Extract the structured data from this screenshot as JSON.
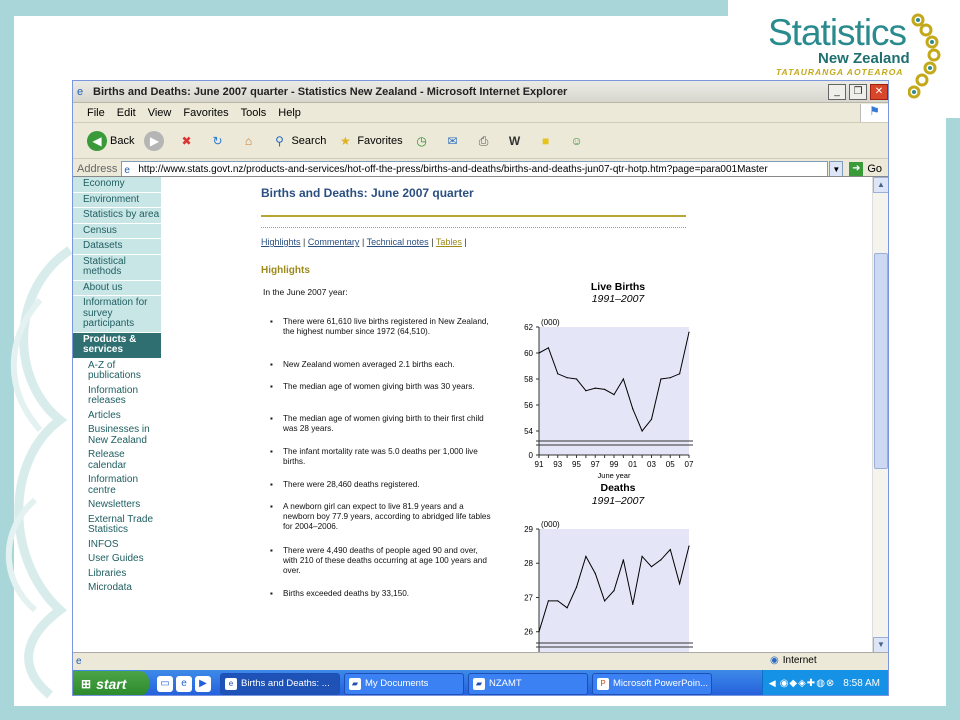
{
  "slide": {
    "logo": {
      "word": "Statistics",
      "country": "New Zealand",
      "tagline": "TATAURANGA AOTEAROA"
    }
  },
  "window": {
    "title": "Births and Deaths: June 2007 quarter - Statistics New Zealand - Microsoft Internet Explorer",
    "controls": {
      "minimize": "_",
      "maximize": "❐",
      "close": "✕"
    },
    "menu": [
      "File",
      "Edit",
      "View",
      "Favorites",
      "Tools",
      "Help"
    ],
    "toolbar": {
      "back": "Back",
      "search": "Search",
      "favorites": "Favorites"
    },
    "address": {
      "label": "Address",
      "url": "http://www.stats.govt.nz/products-and-services/hot-off-the-press/births-and-deaths/births-and-deaths-jun07-qtr-hotp.htm?page=para001Master",
      "go": "Go"
    }
  },
  "nav": {
    "items": [
      "Economy",
      "Environment",
      "Statistics by area",
      "Census",
      "Datasets",
      "Statistical methods",
      "About us",
      "Information for survey participants"
    ],
    "active": "Products & services",
    "subitems": [
      "A-Z of publications",
      "Information releases",
      "Articles",
      "Businesses in New Zealand",
      "Release calendar",
      "Information centre",
      "Newsletters",
      "External Trade Statistics",
      "INFOS",
      "User Guides",
      "Libraries",
      "Microdata"
    ]
  },
  "page": {
    "title": "Births and Deaths: June 2007 quarter",
    "links": [
      "Highlights",
      "Commentary",
      "Technical notes",
      "Tables"
    ],
    "separator": "|",
    "section_heading": "Highlights",
    "intro": "In the June 2007 year:",
    "bullets": [
      "There were 61,610 live births registered in New Zealand, the highest number since 1972 (64,510).",
      "New Zealand women averaged 2.1 births each.",
      "The median age of women giving birth was 30 years.",
      "The median age of women giving birth to their first child was 28 years.",
      "The infant mortality rate was 5.0 deaths per 1,000 live births.",
      "There were 28,460 deaths registered.",
      "A newborn girl can expect to live 81.9 years and a newborn boy 77.9 years, according to abridged life tables for 2004–2006.",
      "There were 4,490 deaths of people aged 90 and over, with 210 of these deaths occurring at age 100 years and over.",
      "Births exceeded deaths by 33,150."
    ]
  },
  "chart_data": [
    {
      "type": "line",
      "title": "Live Births",
      "subtitle": "1991–2007",
      "ylabel": "(000)",
      "xlabel": "June year",
      "x": [
        1991,
        1992,
        1993,
        1994,
        1995,
        1996,
        1997,
        1998,
        1999,
        2000,
        2001,
        2002,
        2003,
        2004,
        2005,
        2006,
        2007
      ],
      "xticks": [
        "91",
        "93",
        "95",
        "97",
        "99",
        "01",
        "03",
        "05",
        "07"
      ],
      "yticks": [
        "0",
        "54",
        "56",
        "58",
        "60",
        "62"
      ],
      "y_axis_break": true,
      "ylim": [
        54,
        62
      ],
      "series": [
        {
          "values": [
            60.0,
            60.4,
            58.4,
            58.1,
            58.0,
            57.1,
            57.3,
            57.2,
            56.8,
            58.0,
            55.7,
            54.0,
            54.9,
            58.0,
            58.1,
            58.4,
            61.6
          ]
        }
      ],
      "colors": {
        "plot_bg": "#e4e6f7",
        "line": "#000000"
      }
    },
    {
      "type": "line",
      "title": "Deaths",
      "subtitle": "1991–2007",
      "ylabel": "(000)",
      "x": [
        1991,
        1992,
        1993,
        1994,
        1995,
        1996,
        1997,
        1998,
        1999,
        2000,
        2001,
        2002,
        2003,
        2004,
        2005,
        2006,
        2007
      ],
      "yticks": [
        "26",
        "27",
        "28",
        "29"
      ],
      "y_axis_break": true,
      "ylim": [
        25.7,
        29
      ],
      "series": [
        {
          "values": [
            26.0,
            26.9,
            26.9,
            26.7,
            27.3,
            28.2,
            27.7,
            26.9,
            27.2,
            28.1,
            26.8,
            28.2,
            27.9,
            28.1,
            28.4,
            27.4,
            28.5
          ]
        }
      ],
      "colors": {
        "plot_bg": "#e4e6f7",
        "line": "#000000"
      }
    }
  ],
  "statusbar": {
    "zone": "Internet"
  },
  "taskbar": {
    "start": "start",
    "tasks": [
      "Births and Deaths: ...",
      "My Documents",
      "NZAMT",
      "Microsoft PowerPoin..."
    ],
    "clock": "8:58 AM"
  }
}
